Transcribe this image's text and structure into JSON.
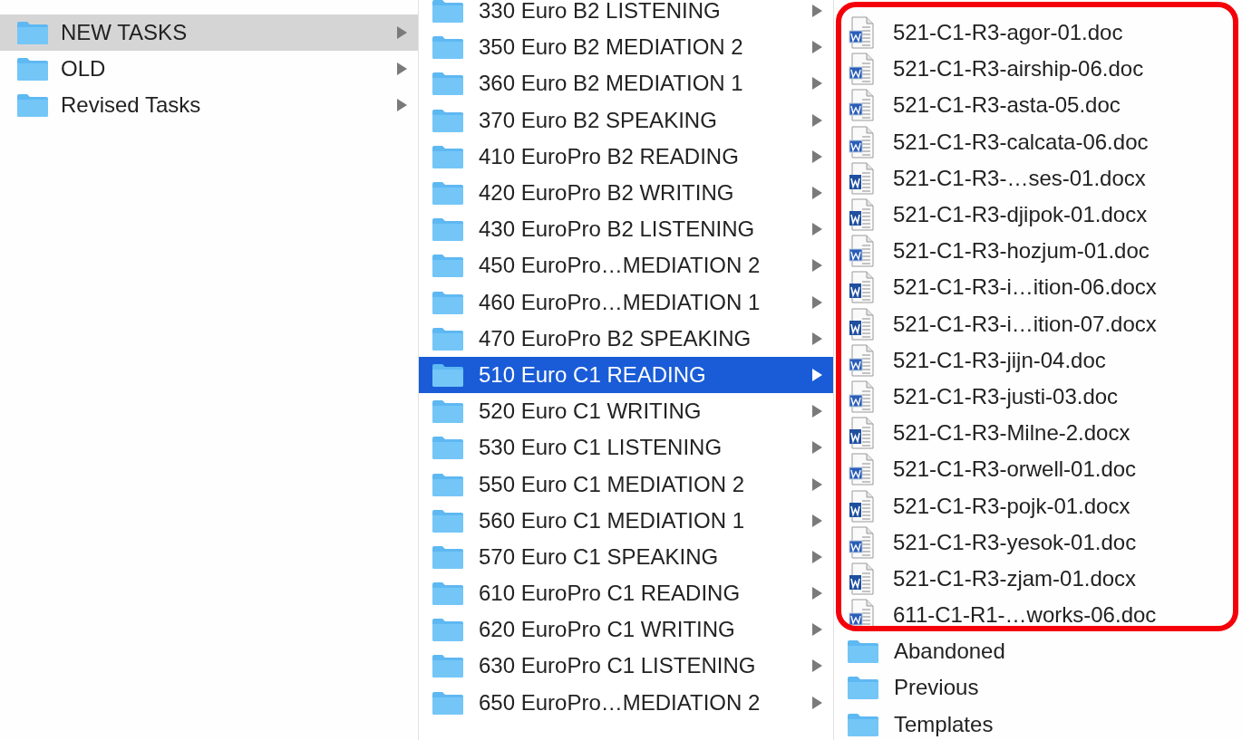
{
  "columns": [
    {
      "focused": false,
      "items": [
        {
          "kind": "folder",
          "name": "NEW TASKS",
          "selected": true
        },
        {
          "kind": "folder",
          "name": "OLD",
          "selected": false
        },
        {
          "kind": "folder",
          "name": "Revised Tasks",
          "selected": false
        }
      ]
    },
    {
      "focused": true,
      "items": [
        {
          "kind": "folder",
          "name": "330 Euro B2 LISTENING",
          "selected": false
        },
        {
          "kind": "folder",
          "name": "350 Euro B2 MEDIATION 2",
          "selected": false
        },
        {
          "kind": "folder",
          "name": "360 Euro B2 MEDIATION 1",
          "selected": false
        },
        {
          "kind": "folder",
          "name": "370 Euro B2 SPEAKING",
          "selected": false
        },
        {
          "kind": "folder",
          "name": "410 EuroPro B2 READING",
          "selected": false
        },
        {
          "kind": "folder",
          "name": "420 EuroPro B2 WRITING",
          "selected": false
        },
        {
          "kind": "folder",
          "name": "430 EuroPro B2 LISTENING",
          "selected": false
        },
        {
          "kind": "folder",
          "name": "450 EuroPro…MEDIATION 2",
          "selected": false
        },
        {
          "kind": "folder",
          "name": "460 EuroPro…MEDIATION 1",
          "selected": false
        },
        {
          "kind": "folder",
          "name": "470 EuroPro B2 SPEAKING",
          "selected": false
        },
        {
          "kind": "folder",
          "name": "510 Euro C1 READING",
          "selected": true
        },
        {
          "kind": "folder",
          "name": "520 Euro C1 WRITING",
          "selected": false
        },
        {
          "kind": "folder",
          "name": "530 Euro C1 LISTENING",
          "selected": false
        },
        {
          "kind": "folder",
          "name": "550 Euro C1 MEDIATION 2",
          "selected": false
        },
        {
          "kind": "folder",
          "name": "560 Euro C1 MEDIATION 1",
          "selected": false
        },
        {
          "kind": "folder",
          "name": "570 Euro C1 SPEAKING",
          "selected": false
        },
        {
          "kind": "folder",
          "name": "610 EuroPro C1 READING",
          "selected": false
        },
        {
          "kind": "folder",
          "name": "620 EuroPro C1 WRITING",
          "selected": false
        },
        {
          "kind": "folder",
          "name": "630 EuroPro C1 LISTENING",
          "selected": false
        },
        {
          "kind": "folder",
          "name": "650 EuroPro…MEDIATION 2",
          "selected": false
        }
      ]
    },
    {
      "items": [
        {
          "kind": "doc",
          "name": "521-C1-R3-agor-01.doc",
          "selected": false
        },
        {
          "kind": "doc",
          "name": "521-C1-R3-airship-06.doc",
          "selected": false
        },
        {
          "kind": "doc",
          "name": "521-C1-R3-asta-05.doc",
          "selected": false
        },
        {
          "kind": "doc",
          "name": "521-C1-R3-calcata-06.doc",
          "selected": false
        },
        {
          "kind": "docx",
          "name": "521-C1-R3-…ses-01.docx",
          "selected": false
        },
        {
          "kind": "docx",
          "name": "521-C1-R3-djipok-01.docx",
          "selected": false
        },
        {
          "kind": "doc",
          "name": "521-C1-R3-hozjum-01.doc",
          "selected": false
        },
        {
          "kind": "docx",
          "name": "521-C1-R3-i…ition-06.docx",
          "selected": false
        },
        {
          "kind": "docx",
          "name": "521-C1-R3-i…ition-07.docx",
          "selected": false
        },
        {
          "kind": "doc",
          "name": "521-C1-R3-jijn-04.doc",
          "selected": false
        },
        {
          "kind": "doc",
          "name": "521-C1-R3-justi-03.doc",
          "selected": false
        },
        {
          "kind": "docx",
          "name": "521-C1-R3-Milne-2.docx",
          "selected": false
        },
        {
          "kind": "doc",
          "name": "521-C1-R3-orwell-01.doc",
          "selected": false
        },
        {
          "kind": "docx",
          "name": "521-C1-R3-pojk-01.docx",
          "selected": false
        },
        {
          "kind": "doc",
          "name": "521-C1-R3-yesok-01.doc",
          "selected": false
        },
        {
          "kind": "docx",
          "name": "521-C1-R3-zjam-01.docx",
          "selected": false
        },
        {
          "kind": "doc",
          "name": "611-C1-R1-…works-06.doc",
          "selected": false
        },
        {
          "kind": "folder",
          "name": "Abandoned",
          "selected": false
        },
        {
          "kind": "folder",
          "name": "Previous",
          "selected": false
        },
        {
          "kind": "folder",
          "name": "Templates",
          "selected": false
        }
      ]
    }
  ]
}
